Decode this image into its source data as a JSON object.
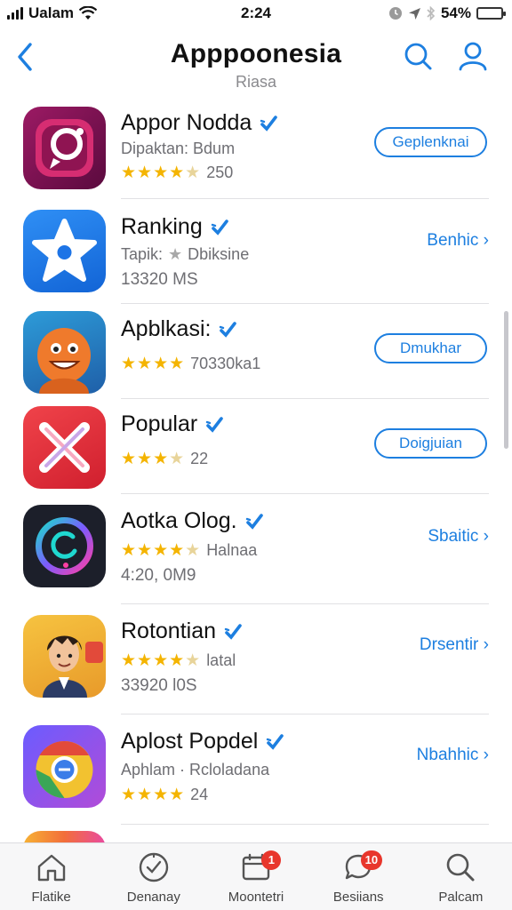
{
  "status_bar": {
    "carrier": "Ualam",
    "time": "2:24",
    "battery": "54%",
    "battery_level": 0.54
  },
  "header": {
    "title": "Apppoonesia",
    "subtitle": "Riasa"
  },
  "apps": [
    {
      "name": "Appor Nodda",
      "line1": "Dipaktan: Bdum",
      "rating_stars": 4.5,
      "line2": "250",
      "action": "Geplenknai",
      "action_style": "pill",
      "icon": "instagram-style-app-icon"
    },
    {
      "name": "Ranking",
      "line1": "Tapik:",
      "line1b": "Dbiksine",
      "line2": "13320 MS",
      "action": "Benhic",
      "action_style": "link",
      "icon": "star-app-icon"
    },
    {
      "name": "Apblkasi:",
      "rating_stars": 4,
      "line2": "70330ka1",
      "action": "Dmukhar",
      "action_style": "pill",
      "icon": "orange-character-app-icon"
    },
    {
      "name": "Popular",
      "rating_stars": 3.5,
      "line2": "22",
      "action": "Doigjuian",
      "action_style": "pill",
      "icon": "x-app-icon"
    },
    {
      "name": "Aotka Olog.",
      "rating_stars": 4.5,
      "line1": "Halnaa",
      "line2": "4:20, 0M9",
      "action": "Sbaitic",
      "action_style": "link",
      "icon": "neon-ring-app-icon"
    },
    {
      "name": "Rotontian",
      "rating_stars": 4.5,
      "line1": "latal",
      "line2": "33920 l0S",
      "action": "Drsentir",
      "action_style": "link",
      "icon": "cartoon-avatar-app-icon"
    },
    {
      "name": "Aplost Popdel",
      "line1": "Aphlam · Rcloladana",
      "rating_stars": 4,
      "line2": "24",
      "action": "Nbahhic",
      "action_style": "link",
      "icon": "chrome-style-app-icon"
    }
  ],
  "tabs": [
    {
      "label": "Flatike",
      "icon": "home-icon",
      "badge": ""
    },
    {
      "label": "Denanay",
      "icon": "compass-check-icon",
      "badge": ""
    },
    {
      "label": "Moontetri",
      "icon": "calendar-icon",
      "badge": "1"
    },
    {
      "label": "Besiians",
      "icon": "chat-bubble-icon",
      "badge": "10"
    },
    {
      "label": "Palcam",
      "icon": "search-icon",
      "badge": ""
    }
  ],
  "colors": {
    "accent": "#1d7fe0",
    "star": "#f4b400",
    "badge": "#e8362c"
  }
}
